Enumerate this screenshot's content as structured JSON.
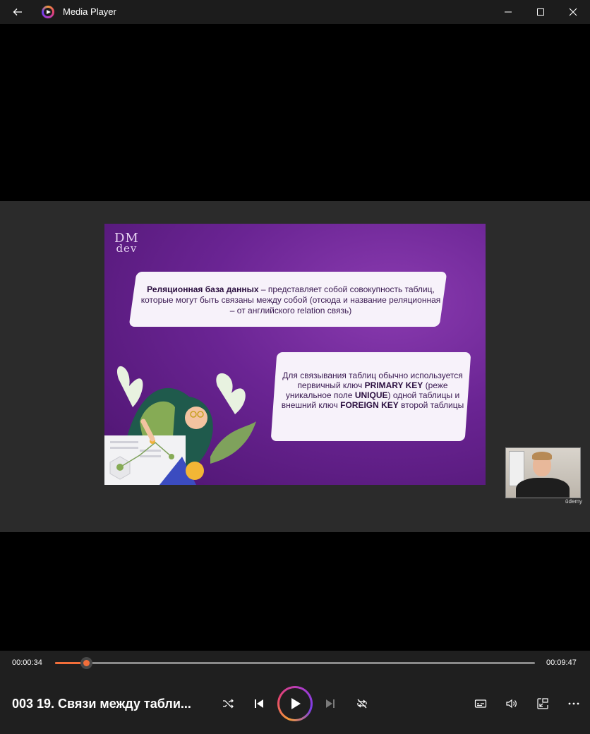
{
  "window": {
    "title": "Media Player"
  },
  "slide": {
    "logo_line1": "DM",
    "logo_line2": "dev",
    "card1": {
      "bold": "Реляционная база данных",
      "text1": " – представляет собой совокупность таблиц, которые могут быть связаны между собой (отсюда и название реляционная – от английского relation связь)"
    },
    "card2": {
      "t1": "Для связывания таблиц обычно используется первичный ключ ",
      "b1": "PRIMARY KEY",
      "t2": " (реже уникальное поле ",
      "b2": "UNIQUE",
      "t3": ") одной таблицы и внешний ключ ",
      "b3": "FOREIGN KEY",
      "t4": " второй таблицы"
    },
    "watermark": "ūdemy"
  },
  "player": {
    "elapsed": "00:00:34",
    "total": "00:09:47",
    "progress_fraction": 0.066,
    "now_playing": "003 19. Связи между табли..."
  },
  "icons": {
    "back": "back-arrow-icon",
    "app": "media-player-icon",
    "minimize": "minimize-icon",
    "maximize": "maximize-icon",
    "close": "close-icon",
    "shuffle": "shuffle-icon",
    "previous": "previous-track-icon",
    "play": "play-icon",
    "next": "next-track-icon",
    "repeat": "repeat-icon",
    "captions": "captions-icon",
    "volume": "volume-icon",
    "miniplayer": "mini-player-icon",
    "more": "more-options-icon"
  },
  "colors": {
    "accent": "#f26e3a",
    "slide_purple": "#6a2493"
  }
}
